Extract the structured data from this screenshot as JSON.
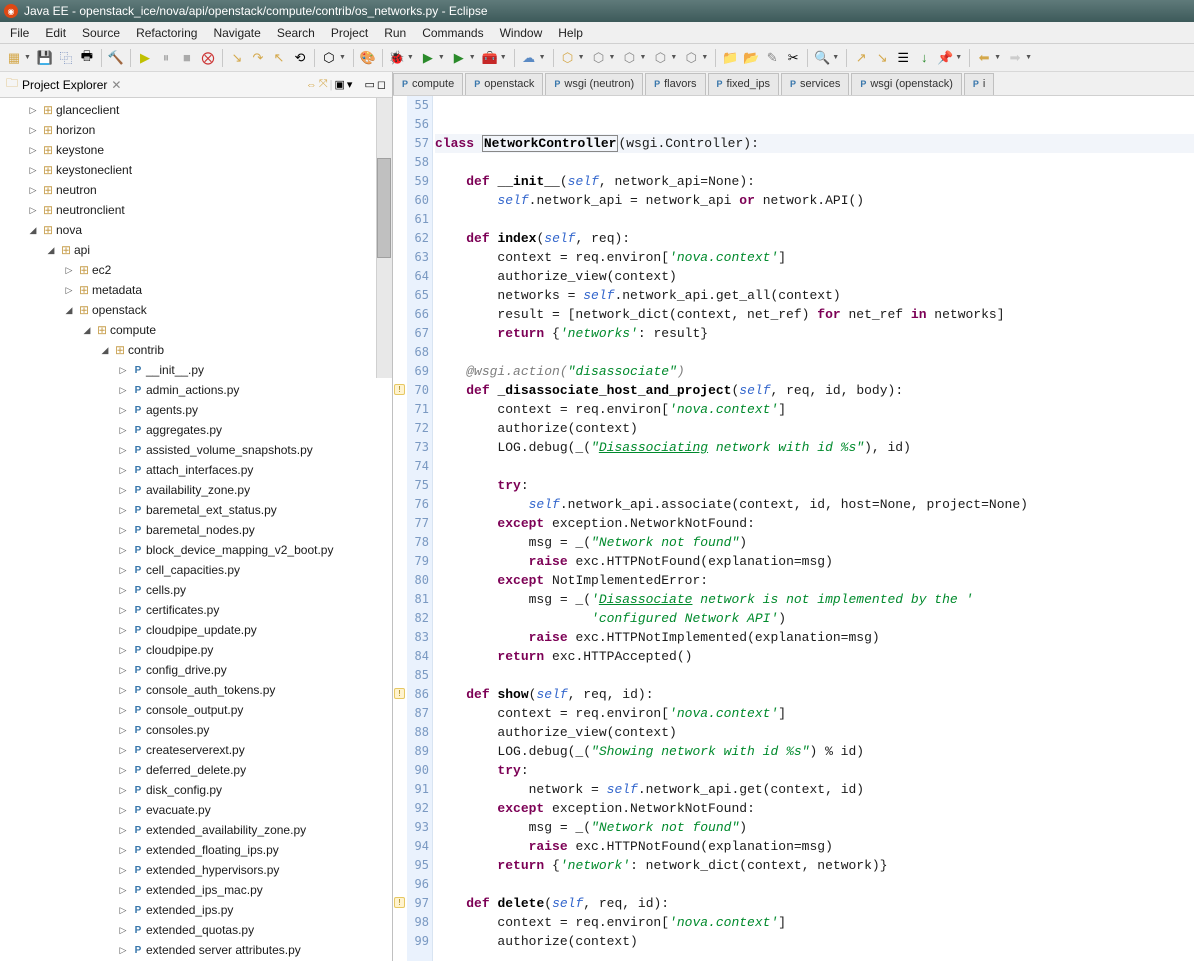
{
  "window": {
    "title": "Java EE - openstack_ice/nova/api/openstack/compute/contrib/os_networks.py - Eclipse"
  },
  "menu": [
    "File",
    "Edit",
    "Source",
    "Refactoring",
    "Navigate",
    "Search",
    "Project",
    "Run",
    "Commands",
    "Window",
    "Help"
  ],
  "sidebar": {
    "title": "Project Explorer",
    "tree": [
      {
        "depth": 1,
        "arrow": "▷",
        "iconCls": "pkg",
        "icon": "⊞",
        "label": "glanceclient"
      },
      {
        "depth": 1,
        "arrow": "▷",
        "iconCls": "pkg",
        "icon": "⊞",
        "label": "horizon"
      },
      {
        "depth": 1,
        "arrow": "▷",
        "iconCls": "pkg",
        "icon": "⊞",
        "label": "keystone"
      },
      {
        "depth": 1,
        "arrow": "▷",
        "iconCls": "pkg",
        "icon": "⊞",
        "label": "keystoneclient"
      },
      {
        "depth": 1,
        "arrow": "▷",
        "iconCls": "pkg",
        "icon": "⊞",
        "label": "neutron"
      },
      {
        "depth": 1,
        "arrow": "▷",
        "iconCls": "pkg",
        "icon": "⊞",
        "label": "neutronclient"
      },
      {
        "depth": 1,
        "arrow": "◢",
        "iconCls": "pkg",
        "icon": "⊞",
        "label": "nova"
      },
      {
        "depth": 2,
        "arrow": "◢",
        "iconCls": "pkg",
        "icon": "⊞",
        "label": "api"
      },
      {
        "depth": 3,
        "arrow": "▷",
        "iconCls": "pkg",
        "icon": "⊞",
        "label": "ec2"
      },
      {
        "depth": 3,
        "arrow": "▷",
        "iconCls": "pkg",
        "icon": "⊞",
        "label": "metadata"
      },
      {
        "depth": 3,
        "arrow": "◢",
        "iconCls": "pkg",
        "icon": "⊞",
        "label": "openstack"
      },
      {
        "depth": 4,
        "arrow": "◢",
        "iconCls": "pkg",
        "icon": "⊞",
        "label": "compute"
      },
      {
        "depth": 5,
        "arrow": "◢",
        "iconCls": "pkg",
        "icon": "⊞",
        "label": "contrib"
      },
      {
        "depth": 6,
        "arrow": "▷",
        "iconCls": "py-icon",
        "icon": "P",
        "label": "__init__.py"
      },
      {
        "depth": 6,
        "arrow": "▷",
        "iconCls": "py-icon",
        "icon": "P",
        "label": "admin_actions.py"
      },
      {
        "depth": 6,
        "arrow": "▷",
        "iconCls": "py-icon",
        "icon": "P",
        "label": "agents.py"
      },
      {
        "depth": 6,
        "arrow": "▷",
        "iconCls": "py-icon",
        "icon": "P",
        "label": "aggregates.py"
      },
      {
        "depth": 6,
        "arrow": "▷",
        "iconCls": "py-icon",
        "icon": "P",
        "label": "assisted_volume_snapshots.py"
      },
      {
        "depth": 6,
        "arrow": "▷",
        "iconCls": "py-icon",
        "icon": "P",
        "label": "attach_interfaces.py"
      },
      {
        "depth": 6,
        "arrow": "▷",
        "iconCls": "py-icon",
        "icon": "P",
        "label": "availability_zone.py"
      },
      {
        "depth": 6,
        "arrow": "▷",
        "iconCls": "py-icon",
        "icon": "P",
        "label": "baremetal_ext_status.py"
      },
      {
        "depth": 6,
        "arrow": "▷",
        "iconCls": "py-icon",
        "icon": "P",
        "label": "baremetal_nodes.py"
      },
      {
        "depth": 6,
        "arrow": "▷",
        "iconCls": "py-icon",
        "icon": "P",
        "label": "block_device_mapping_v2_boot.py"
      },
      {
        "depth": 6,
        "arrow": "▷",
        "iconCls": "py-icon",
        "icon": "P",
        "label": "cell_capacities.py"
      },
      {
        "depth": 6,
        "arrow": "▷",
        "iconCls": "py-icon",
        "icon": "P",
        "label": "cells.py"
      },
      {
        "depth": 6,
        "arrow": "▷",
        "iconCls": "py-icon",
        "icon": "P",
        "label": "certificates.py"
      },
      {
        "depth": 6,
        "arrow": "▷",
        "iconCls": "py-icon",
        "icon": "P",
        "label": "cloudpipe_update.py"
      },
      {
        "depth": 6,
        "arrow": "▷",
        "iconCls": "py-icon",
        "icon": "P",
        "label": "cloudpipe.py"
      },
      {
        "depth": 6,
        "arrow": "▷",
        "iconCls": "py-icon",
        "icon": "P",
        "label": "config_drive.py"
      },
      {
        "depth": 6,
        "arrow": "▷",
        "iconCls": "py-icon",
        "icon": "P",
        "label": "console_auth_tokens.py"
      },
      {
        "depth": 6,
        "arrow": "▷",
        "iconCls": "py-icon",
        "icon": "P",
        "label": "console_output.py"
      },
      {
        "depth": 6,
        "arrow": "▷",
        "iconCls": "py-icon",
        "icon": "P",
        "label": "consoles.py"
      },
      {
        "depth": 6,
        "arrow": "▷",
        "iconCls": "py-icon",
        "icon": "P",
        "label": "createserverext.py"
      },
      {
        "depth": 6,
        "arrow": "▷",
        "iconCls": "py-icon",
        "icon": "P",
        "label": "deferred_delete.py"
      },
      {
        "depth": 6,
        "arrow": "▷",
        "iconCls": "py-icon",
        "icon": "P",
        "label": "disk_config.py"
      },
      {
        "depth": 6,
        "arrow": "▷",
        "iconCls": "py-icon",
        "icon": "P",
        "label": "evacuate.py"
      },
      {
        "depth": 6,
        "arrow": "▷",
        "iconCls": "py-icon",
        "icon": "P",
        "label": "extended_availability_zone.py"
      },
      {
        "depth": 6,
        "arrow": "▷",
        "iconCls": "py-icon",
        "icon": "P",
        "label": "extended_floating_ips.py"
      },
      {
        "depth": 6,
        "arrow": "▷",
        "iconCls": "py-icon",
        "icon": "P",
        "label": "extended_hypervisors.py"
      },
      {
        "depth": 6,
        "arrow": "▷",
        "iconCls": "py-icon",
        "icon": "P",
        "label": "extended_ips_mac.py"
      },
      {
        "depth": 6,
        "arrow": "▷",
        "iconCls": "py-icon",
        "icon": "P",
        "label": "extended_ips.py"
      },
      {
        "depth": 6,
        "arrow": "▷",
        "iconCls": "py-icon",
        "icon": "P",
        "label": "extended_quotas.py"
      },
      {
        "depth": 6,
        "arrow": "▷",
        "iconCls": "py-icon",
        "icon": "P",
        "label": "extended server attributes.py"
      }
    ]
  },
  "editor": {
    "tabs": [
      "compute",
      "openstack",
      "wsgi (neutron)",
      "flavors",
      "fixed_ips",
      "services",
      "wsgi (openstack)",
      "i"
    ],
    "startLine": 55,
    "markers": [
      {
        "line": 70,
        "type": "warning"
      },
      {
        "line": 86,
        "type": "warning"
      },
      {
        "line": 97,
        "type": "warning"
      }
    ],
    "lines": [
      {
        "n": 55,
        "html": ""
      },
      {
        "n": 56,
        "html": ""
      },
      {
        "n": 57,
        "html": "<span class='kw'>class</span> <span class='fn box'>NetworkController</span>(wsgi.Controller):",
        "hl": true
      },
      {
        "n": 58,
        "html": ""
      },
      {
        "n": 59,
        "html": "    <span class='kw'>def</span> <span class='fn'>__init__</span>(<span class='self'>self</span>, network_api=None):"
      },
      {
        "n": 60,
        "html": "        <span class='self'>self</span>.network_api = network_api <span class='kw'>or</span> network.API()"
      },
      {
        "n": 61,
        "html": ""
      },
      {
        "n": 62,
        "html": "    <span class='kw'>def</span> <span class='fn'>index</span>(<span class='self'>self</span>, req):"
      },
      {
        "n": 63,
        "html": "        context = req.environ[<span class='str'>'nova.context'</span>]"
      },
      {
        "n": 64,
        "html": "        authorize_view(context)"
      },
      {
        "n": 65,
        "html": "        networks = <span class='self'>self</span>.network_api.get_all(context)"
      },
      {
        "n": 66,
        "html": "        result = [network_dict(context, net_ref) <span class='kw'>for</span> net_ref <span class='kw'>in</span> networks]"
      },
      {
        "n": 67,
        "html": "        <span class='kw'>return</span> {<span class='str'>'networks'</span>: result}"
      },
      {
        "n": 68,
        "html": ""
      },
      {
        "n": 69,
        "html": "    <span class='dec'>@wsgi.action(</span><span class='str'>\"disassociate\"</span><span class='dec'>)</span>"
      },
      {
        "n": 70,
        "html": "    <span class='kw'>def</span> <span class='fn'>_disassociate_host_and_project</span>(<span class='self'>self</span>, req, id, body):"
      },
      {
        "n": 71,
        "html": "        context = req.environ[<span class='str'>'nova.context'</span>]"
      },
      {
        "n": 72,
        "html": "        authorize(context)"
      },
      {
        "n": 73,
        "html": "        LOG.debug(_(<span class='str'>\"<u>Disassociating</u> network with id %s\"</span>), id)"
      },
      {
        "n": 74,
        "html": ""
      },
      {
        "n": 75,
        "html": "        <span class='kw'>try</span>:"
      },
      {
        "n": 76,
        "html": "            <span class='self'>self</span>.network_api.associate(context, id, host=None, project=None)"
      },
      {
        "n": 77,
        "html": "        <span class='kw'>except</span> exception.NetworkNotFound:"
      },
      {
        "n": 78,
        "html": "            msg = _(<span class='str'>\"Network not found\"</span>)"
      },
      {
        "n": 79,
        "html": "            <span class='kw'>raise</span> exc.HTTPNotFound(explanation=msg)"
      },
      {
        "n": 80,
        "html": "        <span class='kw'>except</span> NotImplementedError:"
      },
      {
        "n": 81,
        "html": "            msg = _(<span class='str'>'<u>Disassociate</u> network is not implemented by the '</span>"
      },
      {
        "n": 82,
        "html": "                    <span class='str'>'configured Network API'</span>)"
      },
      {
        "n": 83,
        "html": "            <span class='kw'>raise</span> exc.HTTPNotImplemented(explanation=msg)"
      },
      {
        "n": 84,
        "html": "        <span class='kw'>return</span> exc.HTTPAccepted()"
      },
      {
        "n": 85,
        "html": ""
      },
      {
        "n": 86,
        "html": "    <span class='kw'>def</span> <span class='fn'>show</span>(<span class='self'>self</span>, req, id):"
      },
      {
        "n": 87,
        "html": "        context = req.environ[<span class='str'>'nova.context'</span>]"
      },
      {
        "n": 88,
        "html": "        authorize_view(context)"
      },
      {
        "n": 89,
        "html": "        LOG.debug(_(<span class='str'>\"Showing network with id %s\"</span>) % id)"
      },
      {
        "n": 90,
        "html": "        <span class='kw'>try</span>:"
      },
      {
        "n": 91,
        "html": "            network = <span class='self'>self</span>.network_api.get(context, id)"
      },
      {
        "n": 92,
        "html": "        <span class='kw'>except</span> exception.NetworkNotFound:"
      },
      {
        "n": 93,
        "html": "            msg = _(<span class='str'>\"Network not found\"</span>)"
      },
      {
        "n": 94,
        "html": "            <span class='kw'>raise</span> exc.HTTPNotFound(explanation=msg)"
      },
      {
        "n": 95,
        "html": "        <span class='kw'>return</span> {<span class='str'>'network'</span>: network_dict(context, network)}"
      },
      {
        "n": 96,
        "html": ""
      },
      {
        "n": 97,
        "html": "    <span class='kw'>def</span> <span class='fn'>delete</span>(<span class='self'>self</span>, req, id):"
      },
      {
        "n": 98,
        "html": "        context = req.environ[<span class='str'>'nova.context'</span>]"
      },
      {
        "n": 99,
        "html": "        authorize(context)"
      }
    ]
  }
}
